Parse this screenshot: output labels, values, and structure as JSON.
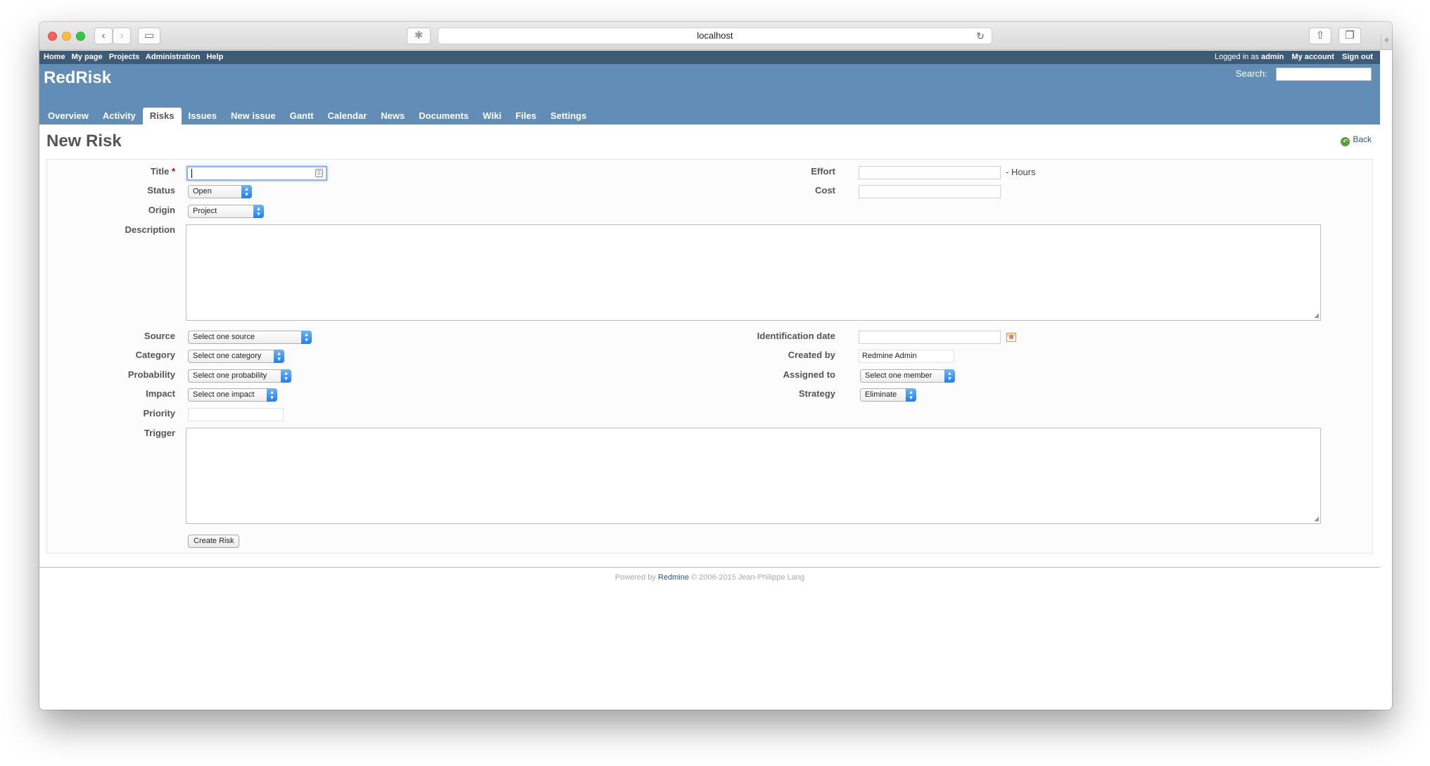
{
  "browser": {
    "url": "localhost",
    "icons": {
      "back": "chevron-left-icon",
      "forward": "chevron-right-icon",
      "sidebar": "sidebar-icon",
      "extension": "puzzle-icon",
      "reload": "reload-icon",
      "share": "share-icon",
      "tabs": "tabs-icon",
      "new_tab": "plus-icon"
    }
  },
  "top_menu": {
    "left": [
      "Home",
      "My page",
      "Projects",
      "Administration",
      "Help"
    ],
    "logged_in_prefix": "Logged in as",
    "user": "admin",
    "my_account": "My account",
    "sign_out": "Sign out"
  },
  "header": {
    "project_title": "RedRisk",
    "search_label": "Search:"
  },
  "main_menu": {
    "tabs": [
      "Overview",
      "Activity",
      "Risks",
      "Issues",
      "New issue",
      "Gantt",
      "Calendar",
      "News",
      "Documents",
      "Wiki",
      "Files",
      "Settings"
    ],
    "selected": "Risks"
  },
  "page": {
    "title": "New Risk",
    "back": "Back"
  },
  "form": {
    "title_label": "Title",
    "required_mark": "*",
    "status_label": "Status",
    "status_value": "Open",
    "origin_label": "Origin",
    "origin_value": "Project",
    "description_label": "Description",
    "effort_label": "Effort",
    "effort_suffix": "- Hours",
    "cost_label": "Cost",
    "source_label": "Source",
    "source_value": "Select one source",
    "category_label": "Category",
    "category_value": "Select one category",
    "probability_label": "Probability",
    "probability_value": "Select one probability",
    "impact_label": "Impact",
    "impact_value": "Select one impact",
    "priority_label": "Priority",
    "trigger_label": "Trigger",
    "identification_date_label": "Identification date",
    "created_by_label": "Created by",
    "created_by_value": "Redmine Admin",
    "assigned_to_label": "Assigned to",
    "assigned_to_value": "Select one member",
    "strategy_label": "Strategy",
    "strategy_value": "Eliminate",
    "submit": "Create Risk"
  },
  "footer": {
    "powered_by": "Powered by",
    "link": "Redmine",
    "copyright": "© 2006-2015 Jean-Philippe Lang"
  },
  "colors": {
    "top_menu": "#3e5b76",
    "header": "#628db6",
    "required": "#bb0000",
    "link": "#2a5685"
  }
}
